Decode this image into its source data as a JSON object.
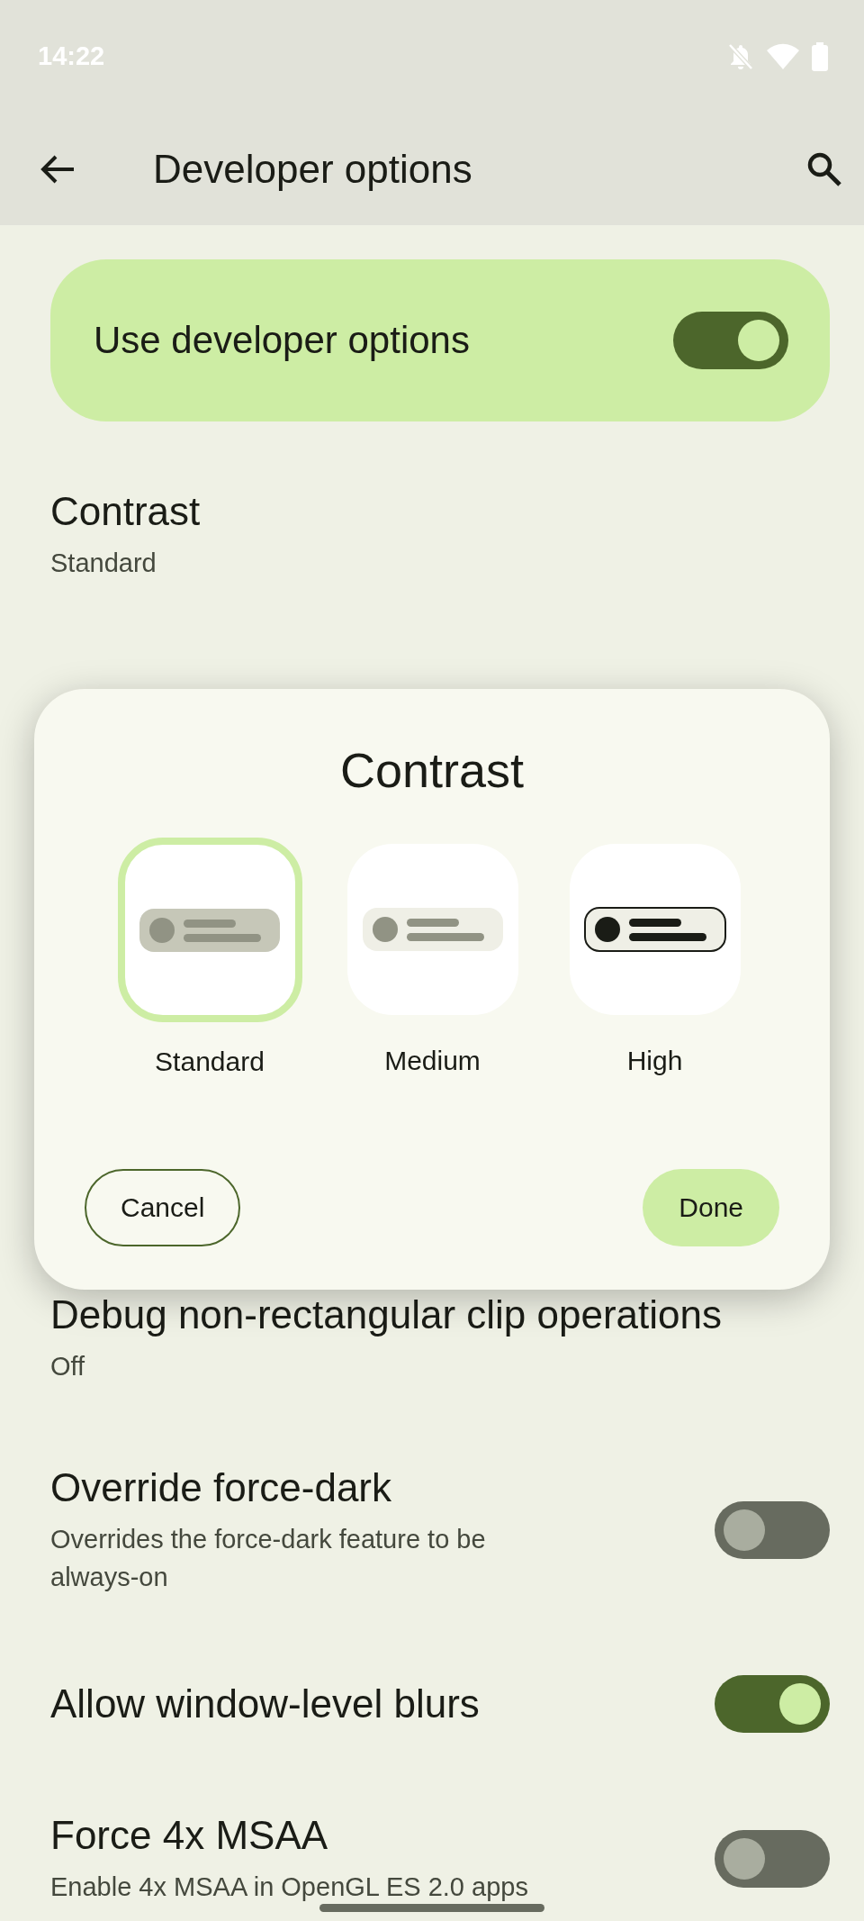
{
  "status_bar": {
    "time": "14:22"
  },
  "app_bar": {
    "title": "Developer options"
  },
  "main_switch": {
    "label": "Use developer options",
    "on": true
  },
  "settings": [
    {
      "kind": "item",
      "title": "Contrast",
      "summary": "Standard"
    },
    {
      "kind": "item",
      "title": "Debug non-rectangular clip operations",
      "summary": "Off"
    },
    {
      "kind": "switch",
      "title": "Override force-dark",
      "summary": "Overrides the force-dark feature to be always-on",
      "on": false
    },
    {
      "kind": "switch",
      "title": "Allow window-level blurs",
      "on": true
    },
    {
      "kind": "switch",
      "title": "Force 4x MSAA",
      "summary": "Enable 4x MSAA in OpenGL ES 2.0 apps",
      "on": false
    }
  ],
  "dialog": {
    "title": "Contrast",
    "options": [
      {
        "kind": "standard",
        "label": "Standard",
        "selected": true
      },
      {
        "kind": "medium",
        "label": "Medium",
        "selected": false
      },
      {
        "kind": "high",
        "label": "High",
        "selected": false
      }
    ],
    "buttons": [
      {
        "kind": "outlined",
        "label": "Cancel"
      },
      {
        "kind": "tonal",
        "label": "Done"
      }
    ]
  }
}
